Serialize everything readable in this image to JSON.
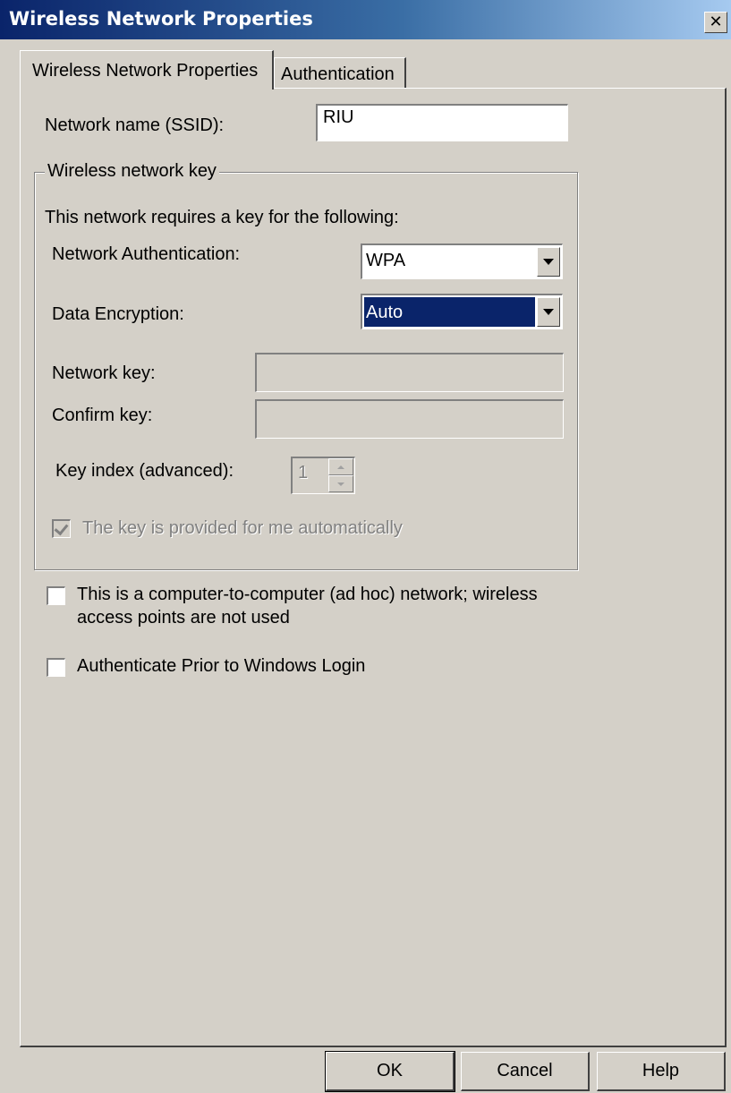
{
  "window": {
    "title": "Wireless Network Properties",
    "close_glyph": "✕"
  },
  "tabs": [
    {
      "label": "Wireless Network Properties",
      "active": true
    },
    {
      "label": "Authentication",
      "active": false
    }
  ],
  "ssid": {
    "label": "Network name (SSID):",
    "value": "RIU"
  },
  "key_group": {
    "title": "Wireless network key",
    "description": "This network requires a key for the following:",
    "auth": {
      "label": "Network Authentication:",
      "value": "WPA"
    },
    "encryption": {
      "label": "Data Encryption:",
      "value": "Auto"
    },
    "network_key": {
      "label": "Network key:",
      "value": ""
    },
    "confirm_key": {
      "label": "Confirm key:",
      "value": ""
    },
    "key_index": {
      "label": "Key index (advanced):",
      "value": "1"
    },
    "auto_key": {
      "label": "The key is provided for me automatically",
      "checked": true,
      "enabled": false
    }
  },
  "adhoc": {
    "label_line1": "This is a computer-to-computer (ad hoc) network; wireless",
    "label_line2": "access points are not used",
    "checked": false
  },
  "prelogin": {
    "label": "Authenticate Prior to Windows Login",
    "checked": false
  },
  "buttons": {
    "ok": "OK",
    "cancel": "Cancel",
    "help": "Help"
  }
}
